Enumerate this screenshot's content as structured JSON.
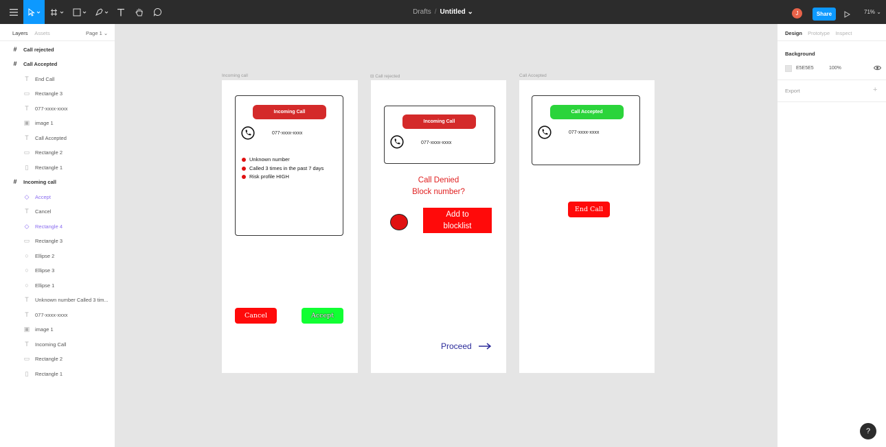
{
  "toolbar": {
    "breadcrumb_folder": "Drafts",
    "breadcrumb_sep": "/",
    "file_name": "Untitled ⌄",
    "avatar_initial": "J",
    "share_label": "Share",
    "zoom": "71% ⌄"
  },
  "left_panel": {
    "tab_layers": "Layers",
    "tab_assets": "Assets",
    "page": "Page 1 ⌄",
    "layers": [
      {
        "label": "Call rejected"
      },
      {
        "label": "Call Accepted"
      },
      {
        "label": "End Call"
      },
      {
        "label": "Rectangle 3"
      },
      {
        "label": "077-xxxx-xxxx"
      },
      {
        "label": "image 1"
      },
      {
        "label": "Call Accepted"
      },
      {
        "label": "Rectangle 2"
      },
      {
        "label": "Rectangle 1"
      },
      {
        "label": "Incoming call"
      },
      {
        "label": "Accept"
      },
      {
        "label": "Cancel"
      },
      {
        "label": "Rectangle 4"
      },
      {
        "label": "Rectangle 3"
      },
      {
        "label": "Ellipse 2"
      },
      {
        "label": "Ellipse 3"
      },
      {
        "label": "Ellipse 1"
      },
      {
        "label": "Unknown number Called 3 tim..."
      },
      {
        "label": "077-xxxx-xxxx"
      },
      {
        "label": "image 1"
      },
      {
        "label": "Incoming Call"
      },
      {
        "label": "Rectangle 2"
      },
      {
        "label": "Rectangle 1"
      }
    ]
  },
  "canvas": {
    "frame1": {
      "label": "Incoming call",
      "header": "Incoming Call",
      "number": "077-xxxx-xxxx",
      "bullets": [
        "Unknown number",
        "Called 3 times in the past 7 days",
        "Risk profile HIGH"
      ],
      "cancel": "Cancel",
      "accept": "Accept"
    },
    "frame2": {
      "label": "Call rejected",
      "header": "Incoming Call",
      "number": "077-xxxx-xxxx",
      "denied_line1": "Call Denied",
      "denied_line2": "Block number?",
      "add_line1": "Add to",
      "add_line2": "blocklist",
      "proceed": "Proceed"
    },
    "frame3": {
      "label": "Call Accepted",
      "header": "Call Accepted",
      "number": "077-xxxx-xxxx",
      "end_call": "End Call"
    }
  },
  "right_panel": {
    "tab_design": "Design",
    "tab_prototype": "Prototype",
    "tab_inspect": "Inspect",
    "background_title": "Background",
    "bg_hex": "E5E5E5",
    "bg_opacity": "100%",
    "export_label": "Export",
    "export_plus": "+"
  },
  "help": "?",
  "colors": {
    "toolbar": "#2c2c2c",
    "accent": "#0d99ff",
    "canvas": "#e5e5e5",
    "red_pill": "#d42a2a",
    "green_pill": "#2bd43b",
    "red_button": "#ff0000",
    "green_button": "#11ff33",
    "proceed": "#2a2a9a"
  }
}
